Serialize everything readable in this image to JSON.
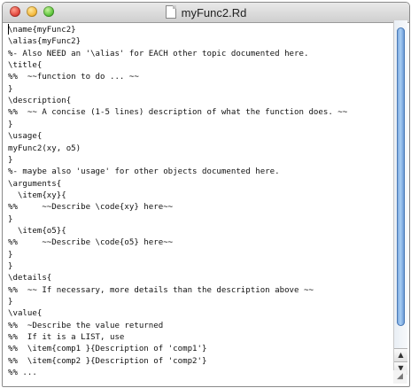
{
  "window": {
    "title": "myFunc2.Rd",
    "doc_icon": "document-icon",
    "scroll_up": "▲",
    "scroll_down": "▼",
    "grip": "◢"
  },
  "editor": {
    "lines": [
      "\\name{myFunc2}",
      "\\alias{myFunc2}",
      "%- Also NEED an '\\alias' for EACH other topic documented here.",
      "\\title{",
      "%%  ~~function to do ... ~~",
      "}",
      "\\description{",
      "%%  ~~ A concise (1-5 lines) description of what the function does. ~~",
      "}",
      "\\usage{",
      "myFunc2(xy, o5)",
      "}",
      "%- maybe also 'usage' for other objects documented here.",
      "\\arguments{",
      "  \\item{xy}{",
      "%%     ~~Describe \\code{xy} here~~",
      "}",
      "  \\item{o5}{",
      "%%     ~~Describe \\code{o5} here~~",
      "}",
      "}",
      "\\details{",
      "%%  ~~ If necessary, more details than the description above ~~",
      "}",
      "\\value{",
      "%%  ~Describe the value returned",
      "%%  If it is a LIST, use",
      "%%  \\item{comp1 }{Description of 'comp1'}",
      "%%  \\item{comp2 }{Description of 'comp2'}",
      "%% ..."
    ]
  }
}
